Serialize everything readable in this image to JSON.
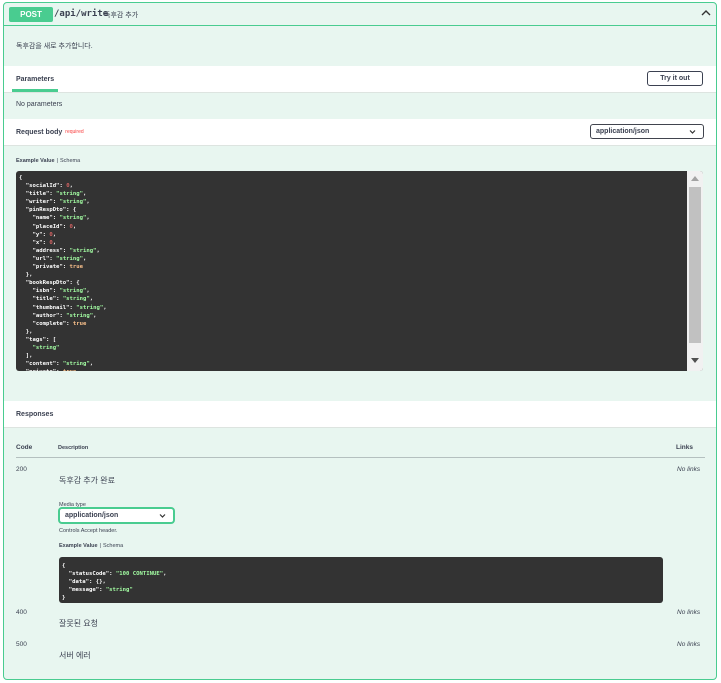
{
  "operation": {
    "method": "POST",
    "path": "/api/write",
    "summary": "독후감 추가",
    "description": "독후감을 새로 추가합니다."
  },
  "parameters": {
    "tab_label": "Parameters",
    "try_label": "Try it out",
    "none_text": "No parameters"
  },
  "request_body": {
    "label": "Request body",
    "required": "required",
    "content_type": "application/json",
    "example_value_label": "Example Value",
    "schema_label": "Schema"
  },
  "responses": {
    "title": "Responses",
    "col_code": "Code",
    "col_description": "Description",
    "col_links": "Links",
    "media_type_label": "Media type",
    "media_type_value": "application/json",
    "controls_text": "Controls Accept header.",
    "example_value_label": "Example Value",
    "schema_label": "Schema",
    "rows": [
      {
        "code": "200",
        "description": "독후감 추가 완료",
        "links": "No links"
      },
      {
        "code": "400",
        "description": "잘못된 요청",
        "links": "No links"
      },
      {
        "code": "500",
        "description": "서버 에러",
        "links": "No links"
      }
    ]
  },
  "colors": {
    "post_green": "#49cc90",
    "block_background": "#e8f6f0",
    "code_background": "#333333",
    "string_green": "#a2fca2",
    "number_red": "#d36363",
    "boolean_orange": "#fcc28c",
    "required_red": "#f93e3e"
  },
  "icons": {
    "collapse": "chevron-up-icon",
    "dropdown": "chevron-down-icon",
    "scroll_up": "triangle-up-icon",
    "scroll_down": "triangle-down-icon"
  }
}
